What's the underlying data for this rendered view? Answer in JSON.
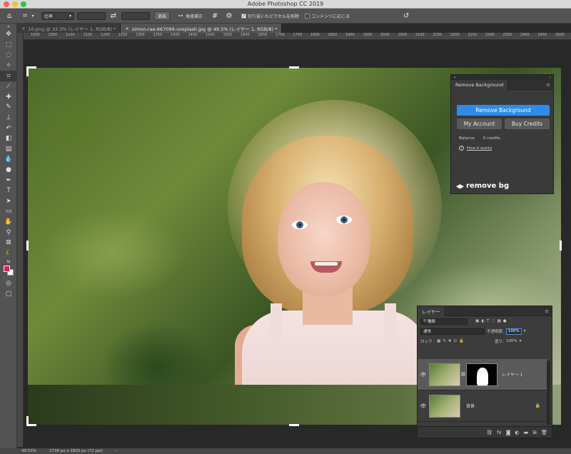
{
  "app": {
    "window_title": "Adobe Photoshop CC 2019",
    "traffic_lights": [
      "#fc5f57",
      "#fdbc2e",
      "#28c840"
    ]
  },
  "options_bar": {
    "ratio_select": "比率",
    "swap_icon": "swap-icon",
    "clear_button": "消去",
    "straighten_label": "角度補正",
    "delete_cropped_label": "切り抜いたピクセルを削除",
    "delete_cropped_checked": true,
    "content_aware_label": "コンテンツに応じる",
    "content_aware_checked": false
  },
  "tabs": [
    {
      "label": "10.png @ 33.3% (レイヤー 1, RGB/8) *",
      "active": false
    },
    {
      "label": "simon-rae-667099-unsplash.jpg @ 49.5% (レイヤー 1, RGB/8) *",
      "active": true
    }
  ],
  "ruler_ticks": [
    "1000",
    "1050",
    "1100",
    "1150",
    "1200",
    "1250",
    "1300",
    "1350",
    "1400",
    "1450",
    "1500",
    "1550",
    "1600",
    "1650",
    "1700",
    "1750",
    "1800",
    "1850",
    "1900",
    "1950",
    "2000",
    "2050",
    "2100",
    "2150",
    "2200",
    "2250",
    "2300",
    "2350",
    "2400",
    "2450",
    "2500"
  ],
  "remove_bg_panel": {
    "tab": "Remove Background",
    "primary_button": "Remove Background",
    "my_account_button": "My Account",
    "buy_credits_button": "Buy Credits",
    "balance_label": "Balance",
    "balance_value": "0 credits",
    "help_link": "How it works",
    "logo_text": "remove bg",
    "primary_color": "#2d8ceb"
  },
  "layers_panel": {
    "tab": "レイヤー",
    "filter_select": "種類",
    "blend_mode": "通常",
    "opacity_label": "不透明度:",
    "opacity_value": "100%",
    "lock_label": "ロック :",
    "fill_label": "塗り:",
    "fill_value": "100%",
    "layers": [
      {
        "name": "レイヤー 1",
        "selected": true,
        "has_mask": true
      },
      {
        "name": "背景",
        "selected": false,
        "has_mask": false,
        "locked": true
      }
    ]
  },
  "status_bar": {
    "zoom": "49.53%",
    "doc_size": "2738 px x 1825 px (72 ppi)"
  }
}
